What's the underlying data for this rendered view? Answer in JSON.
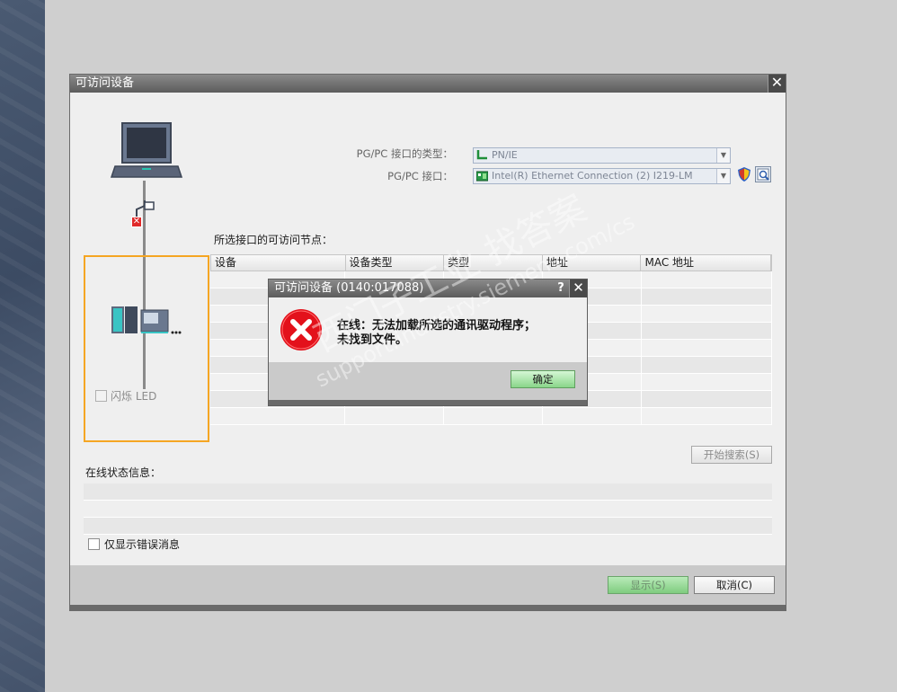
{
  "main_dialog": {
    "title": "可访问设备",
    "close_glyph": "✕",
    "pgpc_type_label": "PG/PC 接口的类型：",
    "pgpc_type_value": "PN/IE",
    "pgpc_iface_label": "PG/PC 接口：",
    "pgpc_iface_value": "Intel(R) Ethernet Connection (2) I219-LM",
    "flash_led_label": "闪烁 LED",
    "nodes_label": "所选接口的可访问节点：",
    "table_headers": [
      "设备",
      "设备类型",
      "类型",
      "地址",
      "MAC 地址"
    ],
    "search_button": "开始搜索(S)",
    "status_label": "在线状态信息：",
    "errors_only_label": "仅显示错误消息",
    "show_button": "显示(S)",
    "cancel_button": "取消(C)"
  },
  "error_dialog": {
    "title": "可访问设备 (0140:017088)",
    "help_glyph": "?",
    "close_glyph": "✕",
    "message_line1": "在线：无法加载所选的通讯驱动程序；",
    "message_line2": "未找到文件。",
    "ok_button": "确定"
  },
  "watermark": {
    "line1": "西门子工业 找答案",
    "line2": "support.industry.siemens.com/cs"
  },
  "colors": {
    "accent_orange": "#f5a623",
    "error_red": "#e02a2a",
    "ok_green": "#8ad68a"
  }
}
